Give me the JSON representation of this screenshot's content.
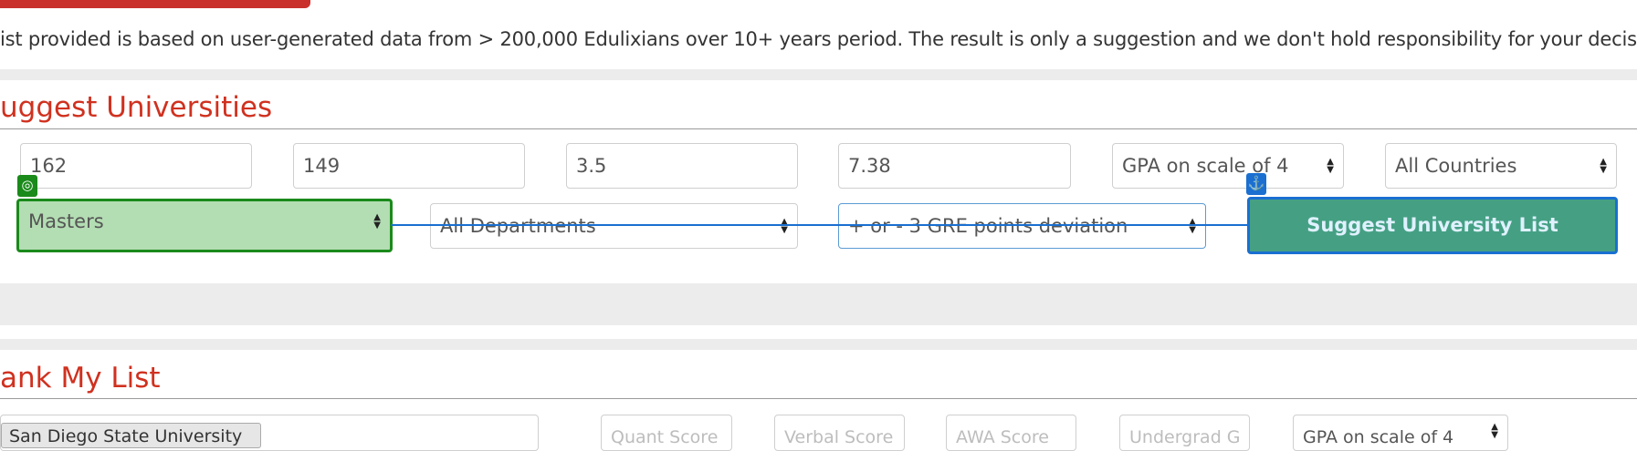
{
  "disclaimer": "ist provided is based on user-generated data from > 200,000 Edulixians over 10+ years period. The result is only a suggestion and we don't hold responsibility for your decision!",
  "suggest": {
    "title": "uggest Universities",
    "quant_value": "162",
    "verbal_value": "149",
    "awa_value": "3.5",
    "undergrad_value": "7.38",
    "gpa_scale": "GPA on scale of 4",
    "country": "All Countries",
    "degree": "Masters",
    "department": "All Departments",
    "deviation": "+ or - 3 GRE points deviation",
    "button_label": "Suggest University List"
  },
  "rank": {
    "title": "ank My List",
    "university_chip": "San Diego State University",
    "quant_placeholder": "Quant Score",
    "verbal_placeholder": "Verbal Score",
    "awa_placeholder": "AWA Score",
    "undergrad_placeholder": "Undergrad G",
    "gpa_scale": "GPA on scale of 4"
  },
  "icons": {
    "target_badge": "target-icon",
    "anchor_badge": "anchor-icon"
  },
  "colors": {
    "accent_red": "#d0311f",
    "button_green": "#45a083",
    "highlight_green": "#1a8a1a",
    "highlight_blue": "#1a6fd1"
  }
}
